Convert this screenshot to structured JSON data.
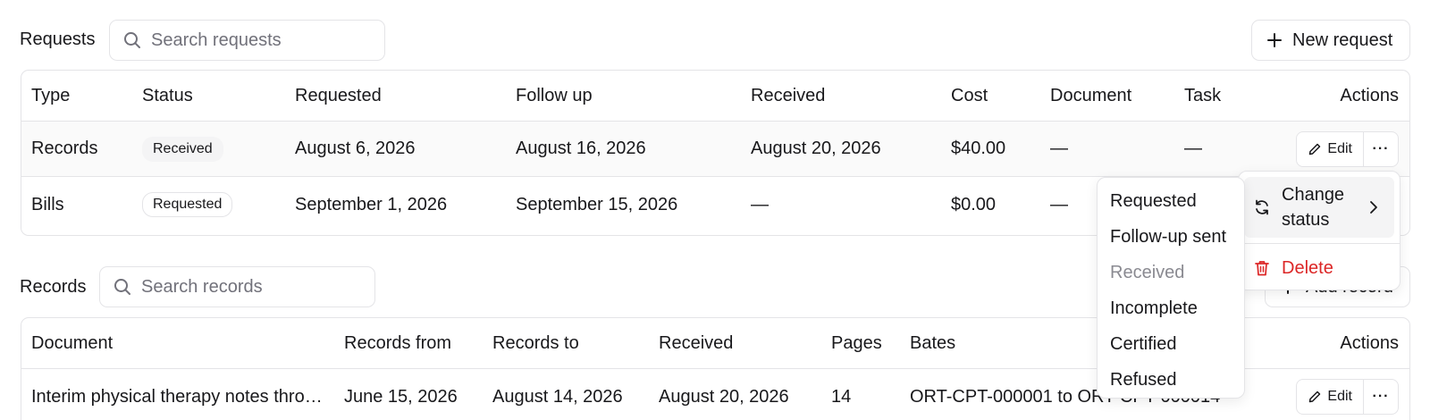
{
  "requests": {
    "title": "Requests",
    "search_placeholder": "Search requests",
    "new_button": "New request",
    "columns": [
      "Type",
      "Status",
      "Requested",
      "Follow up",
      "Received",
      "Cost",
      "Document",
      "Task",
      "Actions"
    ],
    "rows": [
      {
        "type": "Records",
        "status": "Received",
        "requested": "August 6, 2026",
        "follow_up": "August 16, 2026",
        "received": "August 20, 2026",
        "cost": "$40.00",
        "document": "—",
        "task": "—",
        "edit": "Edit",
        "more": "···"
      },
      {
        "type": "Bills",
        "status": "Requested",
        "requested": "September 1, 2026",
        "follow_up": "September 15, 2026",
        "received": "—",
        "cost": "$0.00",
        "document": "—"
      }
    ]
  },
  "records": {
    "title": "Records",
    "search_placeholder": "Search records",
    "add_button": "Add record",
    "columns": [
      "Document",
      "Records from",
      "Records to",
      "Received",
      "Pages",
      "Bates",
      "Actions"
    ],
    "rows": [
      {
        "document": "Interim physical therapy notes thro…",
        "from": "June 15, 2026",
        "to": "August 14, 2026",
        "received": "August 20, 2026",
        "pages": "14",
        "bates": "ORT-CPT-000001 to ORT-CPT-000014",
        "edit": "Edit",
        "more": "···"
      }
    ]
  },
  "status_menu": {
    "items": [
      {
        "label": "Requested",
        "disabled": false
      },
      {
        "label": "Follow-up sent",
        "disabled": false
      },
      {
        "label": "Received",
        "disabled": true
      },
      {
        "label": "Incomplete",
        "disabled": false
      },
      {
        "label": "Certified",
        "disabled": false
      },
      {
        "label": "Refused",
        "disabled": false
      }
    ]
  },
  "actions_menu": {
    "change_status": "Change status",
    "delete": "Delete"
  },
  "colors": {
    "border": "#e4e4e7",
    "text": "#18181b",
    "muted": "#71717a",
    "danger": "#dc2626",
    "hover": "#f4f4f5"
  }
}
